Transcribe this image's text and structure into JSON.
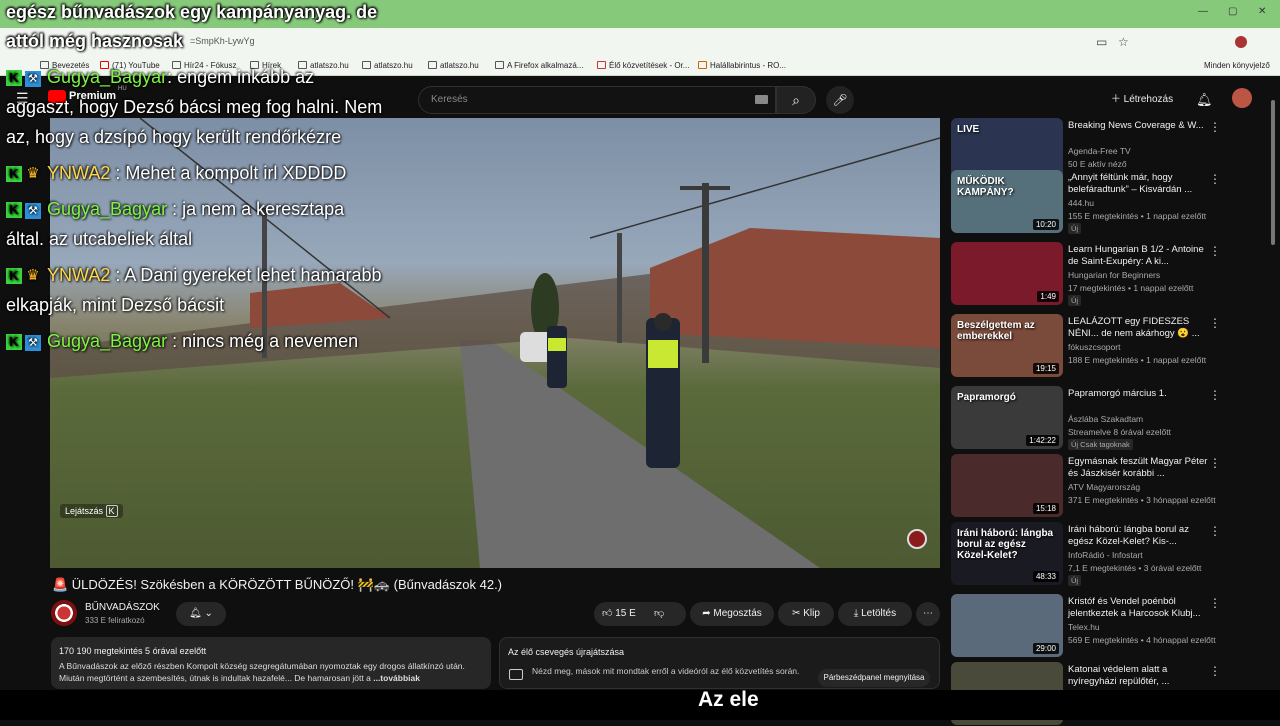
{
  "browser": {
    "url_fragment": "=SmpKh-LywYg",
    "bookmarks": [
      "Bevezetés",
      "(71) YouTube",
      "Hír24 - Fókusz",
      "Hírek",
      "atlatszo.hu",
      "atlatszo.hu",
      "atlatszo.hu",
      "A Firefox alkalmazá...",
      "Élő közvetítések - Or...",
      "Halállabirintus - RO..."
    ],
    "other_bookmarks": "Minden könyvjelző"
  },
  "youtube": {
    "logo": "Premium",
    "logo_region": "HU",
    "search_placeholder": "Keresés",
    "login_label": "Létrehozás"
  },
  "top_captions": {
    "line1": "egész bűnvadászok egy kampányanyag. de",
    "line2": "attól még hasznosak"
  },
  "chat": [
    {
      "user": "Gugya_Bagyar",
      "text": ": engem inkább az",
      "color": "#7ef542",
      "badge": "blue"
    },
    {
      "user": "",
      "text": "aggaszt, hogy Dezső bácsi meg fog halni. Nem",
      "color": "#7ef542",
      "badge": ""
    },
    {
      "user": "",
      "text": "az, hogy a dzsípó hogy került rendőrkézre",
      "color": "#7ef542",
      "badge": ""
    },
    {
      "user": "YNWA2",
      "text": ": Mehet a kompolt irl XDDDD",
      "color": "#ffd84a",
      "badge": "gold"
    },
    {
      "user": "Gugya_Bagyar",
      "text": ": ja nem a keresztapa",
      "color": "#7ef542",
      "badge": "blue"
    },
    {
      "user": "",
      "text": "által. az utcabeliek által",
      "color": "#7ef542",
      "badge": ""
    },
    {
      "user": "YNWA2",
      "text": ": A Dani gyereket lehet hamarabb",
      "color": "#ffd84a",
      "badge": "gold"
    },
    {
      "user": "",
      "text": "elkapják, mint Dezső bácsit",
      "color": "#ffd84a",
      "badge": ""
    },
    {
      "user": "Gugya_Bagyar",
      "text": ": nincs még a nevemen",
      "color": "#7ef542",
      "badge": "blue"
    }
  ],
  "video": {
    "play_hint": "Lejátszás",
    "play_key": "K",
    "title": "🚨 ÜLDÖZÉS! Szökésben a KÖRÖZÖTT BŰNÖZŐ! 🚧🚓 (Bűnvadászok 42.)",
    "channel": "BŰNVADÁSZOK",
    "subscribers": "333 E feliratkozó",
    "likes": "15 E",
    "share_label": "Megosztás",
    "clip_label": "Klip",
    "download_label": "Letöltés",
    "views_meta": "170 190 megtekintés  5 órával ezelőtt",
    "description": "A Bűnvadászok az előző részben Kompolt község szegregátumában nyomoztak egy drogos állatkínzó után. Miután megtörtént a szembesítés, útnak is indultak hazafelé... De hamarosan jött a",
    "more_label": "...továbbiak",
    "chat_replay_title": "Az élő csevegés újrajátszása",
    "chat_replay_text": "Nézd meg, mások mit mondtak erről a videóról az élő közvetítés során.",
    "chat_replay_button": "Párbeszédpanel megnyitása"
  },
  "sidebar": [
    {
      "title": "Breaking News Coverage & W...",
      "channel": "Agenda-Free TV",
      "stats": "50 E aktív néző",
      "duration": "",
      "thumb_color": "#2b3552",
      "thumb_text": "LIVE",
      "tag": ""
    },
    {
      "title": "„Annyit féltünk már, hogy belefáradtunk” – Kisvárdán ...",
      "channel": "444.hu",
      "stats": "155 E megtekintés • 1 nappal ezelőtt",
      "duration": "10:20",
      "thumb_color": "#55707a",
      "thumb_text": "MŰKÖDIK KAMPÁNY?",
      "tag": "Új"
    },
    {
      "title": "Learn Hungarian B 1/2 - Antoine de Saint-Exupéry: A ki...",
      "channel": "Hungarian for Beginners",
      "stats": "17 megtekintés • 1 nappal ezelőtt",
      "duration": "1:49",
      "thumb_color": "#7a1a2a",
      "thumb_text": "",
      "tag": "Új"
    },
    {
      "title": "LEALÁZOTT egy FIDESZES NÉNI... de nem akárhogy 😮 ...",
      "channel": "fókuszcsoport",
      "stats": "188 E megtekintés • 1 nappal ezelőtt",
      "duration": "19:15",
      "thumb_color": "#7a4a3a",
      "thumb_text": "Beszélgettem az emberekkel",
      "tag": ""
    },
    {
      "title": "Papramorgó március 1.",
      "channel": "Ászlába Szakadtam",
      "stats": "Streamelve 8 órával ezelőtt",
      "duration": "1:42:22",
      "thumb_color": "#3a3a3a",
      "thumb_text": "Papramorgó",
      "tag": "Új  Csak tagoknak"
    },
    {
      "title": "Egymásnak feszült Magyar Péter és Jászkisér korábbi ...",
      "channel": "ATV Magyarország",
      "stats": "371 E megtekintés • 3 hónappal ezelőtt",
      "duration": "15:18",
      "thumb_color": "#4a2a2a",
      "thumb_text": "",
      "tag": ""
    },
    {
      "title": "Iráni háború: lángba borul az egész Közel-Kelet? Kis-...",
      "channel": "InfoRádió - Infostart",
      "stats": "7,1 E megtekintés • 3 órával ezelőtt",
      "duration": "48:33",
      "thumb_color": "#1a1a22",
      "thumb_text": "Iráni háború: lángba borul az egész Közel-Kelet?",
      "tag": "Új"
    },
    {
      "title": "Kristóf és Vendel poénból jelentkeztek a Harcosok Klubj...",
      "channel": "Telex.hu",
      "stats": "569 E megtekintés • 4 hónappal ezelőtt",
      "duration": "29:00",
      "thumb_color": "#5a6a7a",
      "thumb_text": "",
      "tag": ""
    },
    {
      "title": "Katonai védelem alatt a nyíregyházi repülőtér, ...",
      "channel": "",
      "stats": "",
      "duration": "",
      "thumb_color": "#4a4a3a",
      "thumb_text": "",
      "tag": ""
    }
  ],
  "bottom_subtitle": "Az ele"
}
